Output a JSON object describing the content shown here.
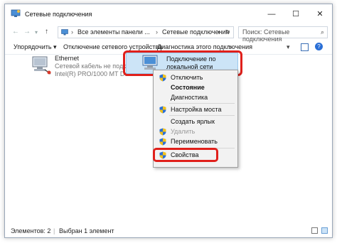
{
  "window": {
    "title": "Сетевые подключения",
    "controls": {
      "minimize": "—",
      "maximize": "☐",
      "close": "✕"
    }
  },
  "address": {
    "crumbs": [
      "Все элементы панели ...",
      "Сетевые подключения"
    ],
    "separator": "›",
    "search_placeholder": "Поиск: Сетевые подключения"
  },
  "toolbar": {
    "organize": "Упорядочить ▾",
    "disable_device": "Отключение сетевого устройства",
    "diagnose": "Диагностика этого подключения",
    "more": "»"
  },
  "adapters": [
    {
      "name": "Ethernet",
      "status": "Сетевой кабель не подключен",
      "device": "Intel(R) PRO/1000 MT Desk..."
    },
    {
      "name": "Подключение по локальной сети",
      "selected": true
    }
  ],
  "context_menu": {
    "items": [
      {
        "label": "Отключить",
        "icon": "shield-icon",
        "style": "normal"
      },
      {
        "label": "Состояние",
        "style": "bold"
      },
      {
        "label": "Диагностика",
        "style": "normal"
      },
      {
        "label": "Настройка моста",
        "icon": "shield-icon",
        "style": "normal"
      },
      {
        "label": "Создать ярлык",
        "style": "normal"
      },
      {
        "label": "Удалить",
        "icon": "shield-icon",
        "style": "disabled"
      },
      {
        "label": "Переименовать",
        "icon": "shield-icon",
        "style": "normal"
      },
      {
        "label": "Свойства",
        "icon": "shield-icon",
        "style": "normal"
      }
    ]
  },
  "status": {
    "count": "Элементов: 2",
    "separator": "|",
    "selected": "Выбран 1 элемент"
  },
  "colors": {
    "selection": "#cce4f7",
    "highlight_red": "#e0201b",
    "accent": "#2a6fd6"
  }
}
